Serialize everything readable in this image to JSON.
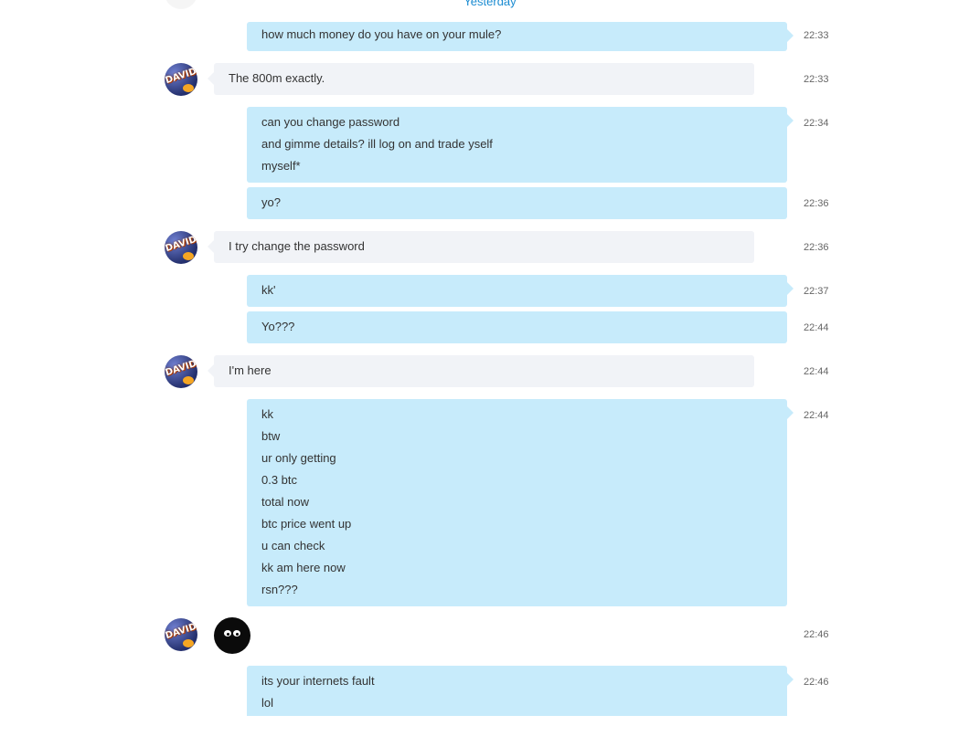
{
  "day_separator": "Yesterday",
  "avatar_label": "DAVID",
  "messages": [
    {
      "dir": "out",
      "lines": [
        "how much money do you have on your mule?"
      ],
      "time": "22:33"
    },
    {
      "dir": "in",
      "lines": [
        "The 800m exactly."
      ],
      "time": "22:33"
    },
    {
      "dir": "out",
      "lines": [
        "can you change password",
        "and gimme details? ill log on and trade yself",
        "myself*"
      ],
      "time": "22:34"
    },
    {
      "dir": "out",
      "lines": [
        "yo?"
      ],
      "time": "22:36"
    },
    {
      "dir": "in",
      "lines": [
        "I try change the password"
      ],
      "time": "22:36"
    },
    {
      "dir": "out",
      "lines": [
        "kk'"
      ],
      "time": "22:37"
    },
    {
      "dir": "out",
      "lines": [
        "Yo???"
      ],
      "time": "22:44"
    },
    {
      "dir": "in",
      "lines": [
        "I'm here"
      ],
      "time": "22:44"
    },
    {
      "dir": "out",
      "lines": [
        "kk",
        "btw",
        "ur only getting",
        "0.3 btc",
        "total now",
        "btc price went up",
        "u can check",
        "kk am here now",
        "rsn???"
      ],
      "time": "22:44"
    },
    {
      "dir": "in",
      "emoticon": "shy-eyes-emoticon",
      "time": "22:46"
    },
    {
      "dir": "out",
      "lines": [
        "its your internets fault",
        "lol"
      ],
      "time": "22:46"
    }
  ]
}
